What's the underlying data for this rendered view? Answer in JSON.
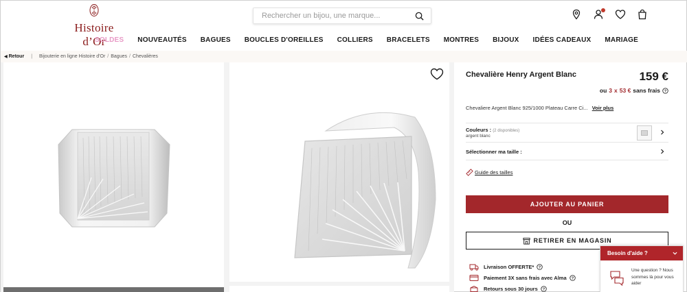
{
  "brand": {
    "name": "Histoire d’Or"
  },
  "search": {
    "placeholder": "Rechercher un bijou, une marque..."
  },
  "header_icons": [
    "map-pin-icon",
    "user-icon",
    "heart-icon",
    "shopping-bag-icon"
  ],
  "nav": {
    "items": [
      {
        "label": "SOLDES",
        "color": "#e89ac6"
      },
      {
        "label": "NOUVEAUTÉS"
      },
      {
        "label": "BAGUES"
      },
      {
        "label": "BOUCLES D'OREILLES"
      },
      {
        "label": "COLLIERS"
      },
      {
        "label": "BRACELETS"
      },
      {
        "label": "MONTRES"
      },
      {
        "label": "BIJOUX"
      },
      {
        "label": "IDÉES CADEAUX"
      },
      {
        "label": "MARIAGE"
      }
    ]
  },
  "breadcrumb": {
    "back": "Retour",
    "items": [
      "Bijouterie en ligne Histoire d'Or",
      "Bagues",
      "Chevalières"
    ]
  },
  "product": {
    "title": "Chevalière Henry Argent Blanc",
    "price": "159 €",
    "installment": {
      "prefix": "ou",
      "count": "3",
      "times": "x",
      "amount": "53 €",
      "suffix": "sans frais"
    },
    "description": "Chevaliere Argent Blanc 925/1000 Plateau Carre Ci...",
    "more_link": "Voir plus",
    "colors": {
      "label": "Couleurs :",
      "available": "(2 disponibles)",
      "selected": "argent blanc"
    },
    "size_label": "Sélectionner ma taille :",
    "size_guide": "Guide des tailles",
    "add_to_cart": "AJOUTER AU PANIER",
    "or": "OU",
    "pickup": "RETIRER EN MAGASIN",
    "perks": [
      {
        "text": "Livraison",
        "extra": "OFFERTE*"
      },
      {
        "text": "Paiement 3X sans frais avec Alma"
      },
      {
        "text": "Retours sous 30 jours"
      }
    ]
  },
  "help": {
    "title": "Besoin d'aide ?",
    "line1": "Une question ? Nous",
    "line2": "sommes là pour vous",
    "line3": "aider"
  },
  "colors": {
    "brand_red": "#a3272b",
    "sale_pink": "#e89ac6"
  }
}
